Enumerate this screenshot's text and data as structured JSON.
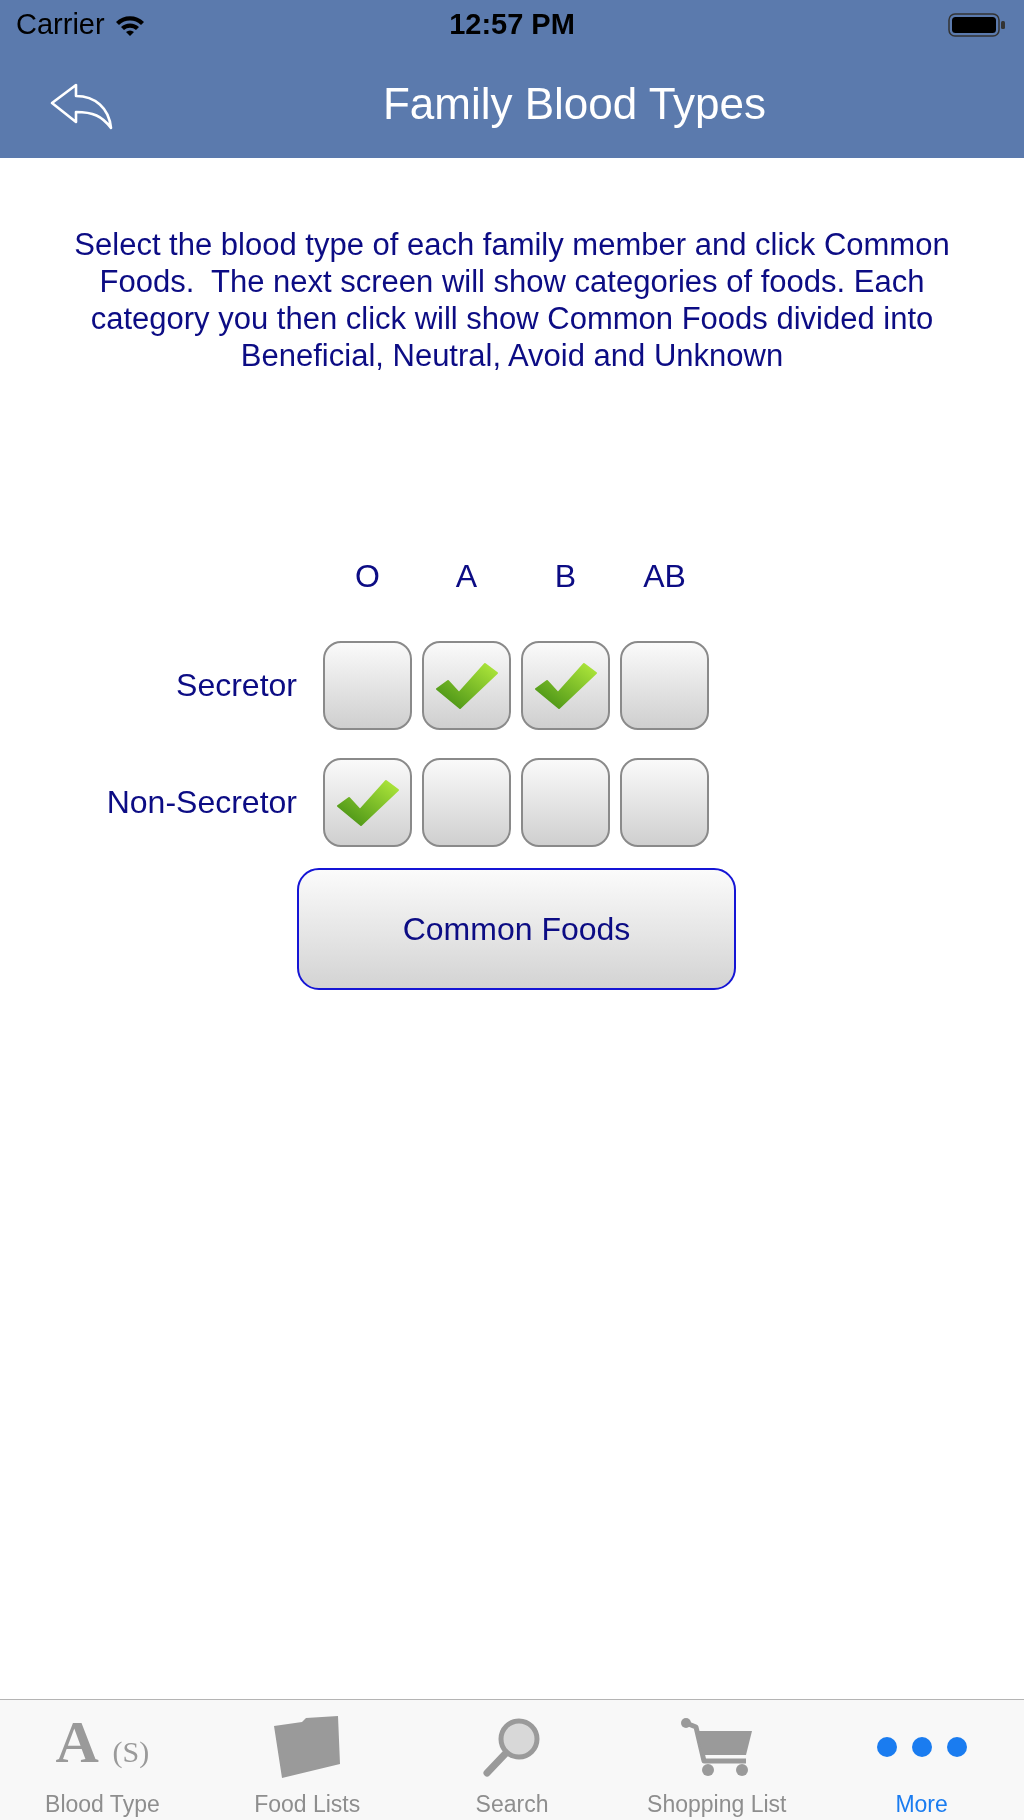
{
  "status_bar": {
    "carrier": "Carrier",
    "time": "12:57 PM"
  },
  "nav_bar": {
    "title": "Family Blood Types"
  },
  "instructions": "Select the blood type of each family member and click Common Foods.  The next screen will show categories of foods. Each category you then click will show Common Foods divided into Beneficial, Neutral, Avoid and Unknown",
  "grid": {
    "columns": [
      "O",
      "A",
      "B",
      "AB"
    ],
    "rows": [
      {
        "label": "Secretor",
        "cells": [
          {
            "checked": false
          },
          {
            "checked": true
          },
          {
            "checked": true
          },
          {
            "checked": false
          }
        ]
      },
      {
        "label": "Non-Secretor",
        "cells": [
          {
            "checked": true
          },
          {
            "checked": false
          },
          {
            "checked": false
          },
          {
            "checked": false
          }
        ]
      }
    ]
  },
  "button": {
    "label": "Common Foods"
  },
  "tab_bar": {
    "tabs": [
      {
        "kind": "letters",
        "icon_letter": "A",
        "icon_mark": "(S)",
        "label": "Blood Type",
        "selected": false
      },
      {
        "kind": "folder",
        "label": "Food Lists",
        "selected": false
      },
      {
        "kind": "search",
        "label": "Search",
        "selected": false
      },
      {
        "kind": "cart",
        "label": "Shopping List",
        "selected": false
      },
      {
        "kind": "more",
        "label": "More",
        "selected": true
      }
    ]
  }
}
